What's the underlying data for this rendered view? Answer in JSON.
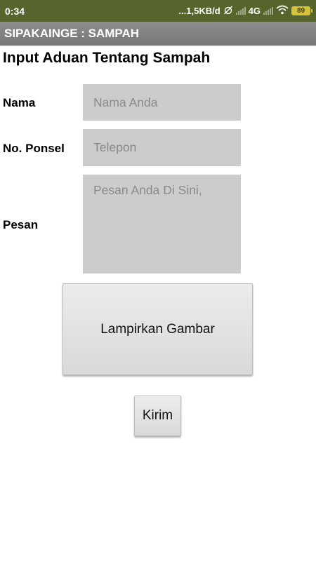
{
  "status_bar": {
    "time": "0:34",
    "network_speed": "...1,5KB/d",
    "network_type": "4G",
    "battery_level": "89",
    "background_color": "#56652b",
    "icons": [
      "alarm-off-icon",
      "signal-icon",
      "wifi-icon",
      "battery-icon"
    ]
  },
  "app_bar": {
    "title": "SIPAKAINGE : SAMPAH",
    "background_color": "#808080"
  },
  "form": {
    "heading": "Input Aduan Tentang Sampah",
    "name_label": "Nama",
    "name_placeholder": "Nama Anda",
    "name_value": "",
    "phone_label": "No. Ponsel",
    "phone_placeholder": "Telepon",
    "phone_value": "",
    "message_label": "Pesan",
    "message_placeholder": "Pesan Anda Di Sini,",
    "message_value": ""
  },
  "buttons": {
    "attach_label": "Lampirkan Gambar",
    "send_label": "Kirim"
  }
}
